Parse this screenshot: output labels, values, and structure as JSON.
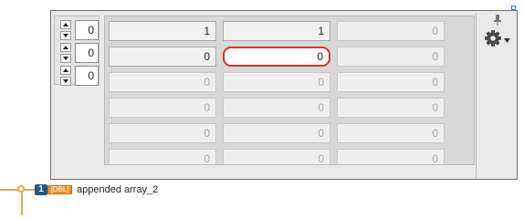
{
  "array_indices": [
    "0",
    "0",
    "0"
  ],
  "grid": {
    "rows": [
      [
        {
          "value": "1",
          "dim": false
        },
        {
          "value": "1",
          "dim": false
        },
        {
          "value": "0",
          "dim": true
        }
      ],
      [
        {
          "value": "0",
          "dim": false
        },
        {
          "value": "0",
          "dim": false,
          "active": true
        },
        {
          "value": "0",
          "dim": true
        }
      ],
      [
        {
          "value": "0",
          "dim": true
        },
        {
          "value": "0",
          "dim": true
        },
        {
          "value": "0",
          "dim": true
        }
      ],
      [
        {
          "value": "0",
          "dim": true
        },
        {
          "value": "0",
          "dim": true
        },
        {
          "value": "0",
          "dim": true
        }
      ],
      [
        {
          "value": "0",
          "dim": true
        },
        {
          "value": "0",
          "dim": true
        },
        {
          "value": "0",
          "dim": true
        }
      ],
      [
        {
          "value": "0",
          "dim": true
        },
        {
          "value": "0",
          "dim": true
        },
        {
          "value": "0",
          "dim": true
        }
      ]
    ]
  },
  "icons": {
    "pin": "pin-icon",
    "gear": "gear-icon",
    "caret": "chevron-down-icon",
    "increment": "chevron-up-icon",
    "decrement": "chevron-down-icon"
  },
  "node": {
    "number": "1",
    "type_tag": "[DBL]",
    "label": "appended array_2"
  },
  "colors": {
    "active_border": "#d9312e",
    "wire": "#f0a44a",
    "type_badge": "#f19126",
    "number_badge": "#1c5a88"
  }
}
